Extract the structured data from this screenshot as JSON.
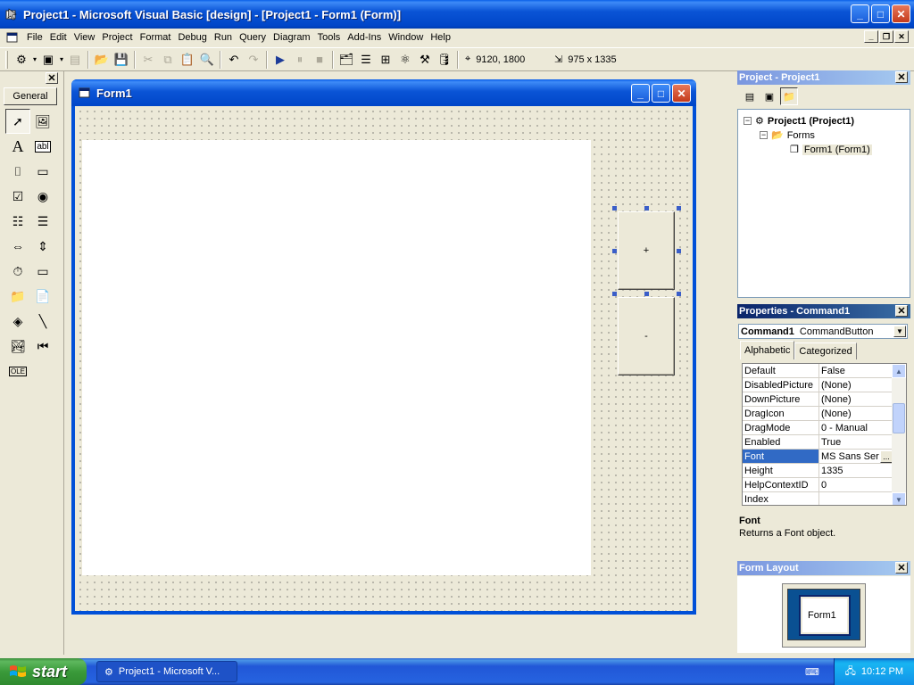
{
  "app": {
    "title": "Project1 - Microsoft Visual Basic [design] - [Project1 - Form1 (Form)]",
    "minimize": "_",
    "maximize": "□",
    "close": "✕"
  },
  "menu": {
    "items": [
      "File",
      "Edit",
      "View",
      "Project",
      "Format",
      "Debug",
      "Run",
      "Query",
      "Diagram",
      "Tools",
      "Add-Ins",
      "Window",
      "Help"
    ]
  },
  "toolbar": {
    "position": "9120, 1800",
    "size": "975 x 1335"
  },
  "toolbox": {
    "tab_label": "General",
    "close": "✕"
  },
  "form_window": {
    "title": "Form1",
    "command_top_caption": "+",
    "command_bottom_caption": "-"
  },
  "project_panel": {
    "title": "Project - Project1",
    "close": "✕",
    "tree": {
      "project": "Project1 (Project1)",
      "folder": "Forms",
      "form": "Form1 (Form1)"
    }
  },
  "properties_panel": {
    "title": "Properties - Command1",
    "close": "✕",
    "object_name": "Command1",
    "object_type": "CommandButton",
    "tabs": [
      "Alphabetic",
      "Categorized"
    ],
    "rows": [
      {
        "name": "Default",
        "value": "False"
      },
      {
        "name": "DisabledPicture",
        "value": "(None)"
      },
      {
        "name": "DownPicture",
        "value": "(None)"
      },
      {
        "name": "DragIcon",
        "value": "(None)"
      },
      {
        "name": "DragMode",
        "value": "0 - Manual"
      },
      {
        "name": "Enabled",
        "value": "True"
      },
      {
        "name": "Font",
        "value": "MS Sans Ser"
      },
      {
        "name": "Height",
        "value": "1335"
      },
      {
        "name": "HelpContextID",
        "value": "0"
      },
      {
        "name": "Index",
        "value": ""
      }
    ],
    "description_name": "Font",
    "description_text": "Returns a Font object."
  },
  "form_layout_panel": {
    "title": "Form Layout",
    "close": "✕",
    "form_label": "Form1"
  },
  "taskbar": {
    "start_label": "start",
    "task_label": "Project1 - Microsoft V...",
    "clock": "10:12 PM"
  },
  "colors": {
    "selection": "#316AC5",
    "titlebar": "#0A54D6",
    "start_green": "#3A9A3A"
  }
}
